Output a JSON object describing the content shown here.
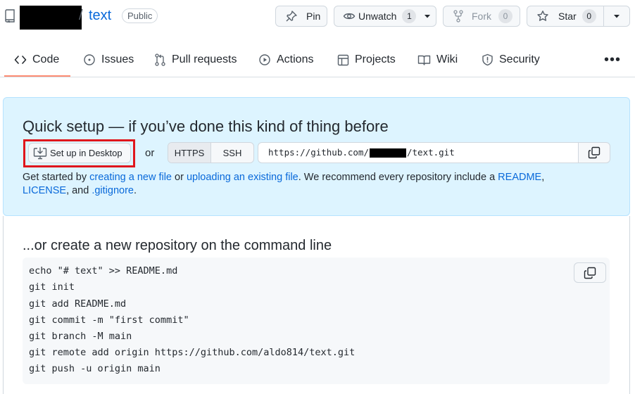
{
  "repo": {
    "slash": "/",
    "name": "text",
    "visibility": "Public"
  },
  "actions": {
    "pin_label": "Pin",
    "watch_label": "Unwatch",
    "watch_count": "1",
    "fork_label": "Fork",
    "fork_count": "0",
    "star_label": "Star",
    "star_count": "0"
  },
  "tabs": [
    {
      "label": "Code",
      "icon": "code-icon"
    },
    {
      "label": "Issues",
      "icon": "issue-icon"
    },
    {
      "label": "Pull requests",
      "icon": "pull-request-icon"
    },
    {
      "label": "Actions",
      "icon": "play-icon"
    },
    {
      "label": "Projects",
      "icon": "table-icon"
    },
    {
      "label": "Wiki",
      "icon": "book-icon"
    },
    {
      "label": "Security",
      "icon": "shield-icon"
    }
  ],
  "more_label": "•••",
  "quick_setup": {
    "title": "Quick setup — if you’ve done this kind of thing before",
    "desktop_button": "Set up in Desktop",
    "or_text": "or",
    "protocols": [
      "HTTPS",
      "SSH"
    ],
    "url_prefix": "https://github.com/",
    "url_suffix": "/text.git",
    "text_1": "Get started by ",
    "link_create": "creating a new file",
    "text_2": " or ",
    "link_upload": "uploading an existing file",
    "text_3": ". We recommend every repository include a ",
    "link_readme": "README",
    "text_4": ", ",
    "link_license": "LICENSE",
    "text_5": ", and ",
    "link_gitignore": ".gitignore",
    "text_6": "."
  },
  "command_line": {
    "title": "...or create a new repository on the command line",
    "lines": [
      "echo \"# text\" >> README.md",
      "git init",
      "git add README.md",
      "git commit -m \"first commit\"",
      "git branch -M main",
      "git remote add origin https://github.com/aldo814/text.git",
      "git push -u origin main"
    ]
  },
  "colors": {
    "accent_link": "#0969da",
    "highlight_box": "#e0161c",
    "quick_setup_bg": "#ddf4ff",
    "tab_underline": "#fd8c73"
  }
}
